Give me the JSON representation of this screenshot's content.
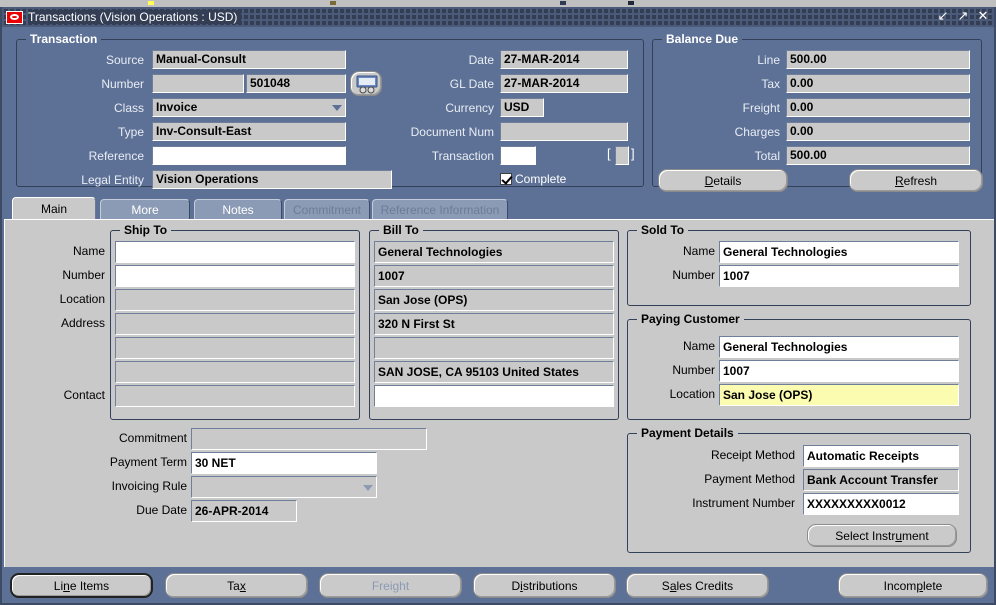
{
  "window": {
    "title": "Transactions (Vision Operations : USD)",
    "logo_icon": "oracle-logo-icon",
    "controls": [
      {
        "name": "minimize-button",
        "glyph": "↙"
      },
      {
        "name": "maximize-button",
        "glyph": "↗"
      },
      {
        "name": "close-button",
        "glyph": "✕"
      }
    ]
  },
  "header": {
    "group_title": "Transaction",
    "labels": {
      "source": "Source",
      "number": "Number",
      "class": "Class",
      "type": "Type",
      "reference": "Reference",
      "legal_entity": "Legal Entity",
      "date": "Date",
      "gl_date": "GL Date",
      "currency": "Currency",
      "document_num": "Document Num",
      "transaction": "Transaction"
    },
    "values": {
      "source": "Manual-Consult",
      "number_prefix": "",
      "number": "501048",
      "class": "Invoice",
      "type": "Inv-Consult-East",
      "reference": "",
      "legal_entity": "Vision Operations",
      "date": "27-MAR-2014",
      "gl_date": "27-MAR-2014",
      "currency": "USD",
      "document_num": "",
      "transaction": "",
      "transaction_bracket_left": "[",
      "transaction_bracket_right": "]"
    },
    "complete_checkbox_label": "Complete",
    "number_icon": "truck-icon"
  },
  "balance_due": {
    "group_title": "Balance Due",
    "rows": [
      {
        "label": "Line",
        "value": "500.00"
      },
      {
        "label": "Tax",
        "value": "0.00"
      },
      {
        "label": "Freight",
        "value": "0.00"
      },
      {
        "label": "Charges",
        "value": "0.00"
      },
      {
        "label": "Total",
        "value": "500.00"
      }
    ],
    "details_button": "Details",
    "refresh_button": "Refresh"
  },
  "tabs": [
    {
      "label": "Main",
      "state": "active"
    },
    {
      "label": "More",
      "state": "enabled"
    },
    {
      "label": "Notes",
      "state": "enabled"
    },
    {
      "label": "Commitment",
      "state": "disabled"
    },
    {
      "label": "Reference Information",
      "state": "disabled"
    }
  ],
  "ship_to": {
    "group_title": "Ship To",
    "labels": {
      "name": "Name",
      "number": "Number",
      "location": "Location",
      "address": "Address",
      "contact": "Contact"
    },
    "values": {
      "name": "",
      "number": "",
      "location": "",
      "address1": "",
      "address2": "",
      "address3": "",
      "contact": ""
    }
  },
  "bill_to": {
    "group_title": "Bill To",
    "values": {
      "name": "General Technologies",
      "number": "1007",
      "location": "San Jose (OPS)",
      "address1": "320 N First St",
      "address2": "",
      "address3": "SAN JOSE, CA 95103 United States",
      "contact": ""
    }
  },
  "sold_to": {
    "group_title": "Sold To",
    "labels": {
      "name": "Name",
      "number": "Number"
    },
    "values": {
      "name": "General Technologies",
      "number": "1007"
    }
  },
  "paying_customer": {
    "group_title": "Paying Customer",
    "labels": {
      "name": "Name",
      "number": "Number",
      "location": "Location"
    },
    "values": {
      "name": "General Technologies",
      "number": "1007",
      "location": "San Jose (OPS)"
    },
    "location_highlight_color": "#fcfcb0"
  },
  "terms": {
    "labels": {
      "commitment": "Commitment",
      "payment_term": "Payment Term",
      "invoicing_rule": "Invoicing Rule",
      "due_date": "Due Date"
    },
    "values": {
      "commitment": "",
      "payment_term": "30 NET",
      "invoicing_rule": "",
      "due_date": "26-APR-2014"
    }
  },
  "payment_details": {
    "group_title": "Payment Details",
    "labels": {
      "receipt_method": "Receipt Method",
      "payment_method": "Payment Method",
      "instrument_number": "Instrument Number"
    },
    "values": {
      "receipt_method": "Automatic Receipts",
      "payment_method": "Bank Account Transfer",
      "instrument_number": "XXXXXXXXX0012"
    },
    "select_instrument_button": "Select Instrument"
  },
  "footer_buttons": [
    {
      "label": "Line Items",
      "mnemonic": "n",
      "state": "focused"
    },
    {
      "label": "Tax",
      "mnemonic": "x",
      "state": "enabled"
    },
    {
      "label": "Freight",
      "mnemonic": "",
      "state": "disabled"
    },
    {
      "label": "Distributions",
      "mnemonic": "i",
      "state": "enabled"
    },
    {
      "label": "Sales Credits",
      "mnemonic": "a",
      "state": "enabled"
    },
    {
      "label": "Incomplete",
      "mnemonic": "p",
      "state": "enabled"
    }
  ],
  "colors": {
    "window_chrome": "#5d7196",
    "titlebar": "#333e55",
    "canvas": "#c9c9c9",
    "field_readonly": "#c9c9c9",
    "field_editable": "#ffffff",
    "field_current": "#fcfcb0"
  }
}
